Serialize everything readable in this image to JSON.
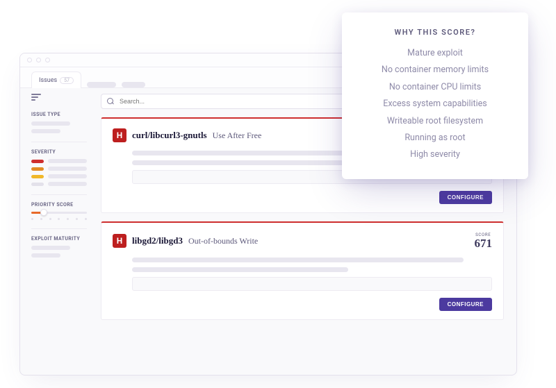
{
  "tabs": {
    "active_label": "Issues",
    "active_count": "57"
  },
  "search": {
    "placeholder": "Search..."
  },
  "sidebar": {
    "sections": {
      "issue_type": "ISSUE TYPE",
      "severity": "SEVERITY",
      "priority_score": "PRIORITY SCORE",
      "exploit_maturity": "EXPLOIT MATURITY"
    }
  },
  "severity_colors": [
    "#CE2E2E",
    "#E28C26",
    "#F0B82A"
  ],
  "cards": [
    {
      "severity_letter": "H",
      "package": "curl/libcurl3-gnutls",
      "vulnerability": "Use After Free",
      "configure_label": "CONFIGURE"
    },
    {
      "severity_letter": "H",
      "package": "libgd2/libgd3",
      "vulnerability": "Out-of-bounds Write",
      "score_label": "SCORE",
      "score_value": "671",
      "configure_label": "CONFIGURE"
    }
  ],
  "popover": {
    "title": "WHY THIS SCORE?",
    "reasons": [
      "Mature exploit",
      "No container memory limits",
      "No container CPU limits",
      "Excess system capabilities",
      "Writeable root filesystem",
      "Running as root",
      "High severity"
    ]
  }
}
